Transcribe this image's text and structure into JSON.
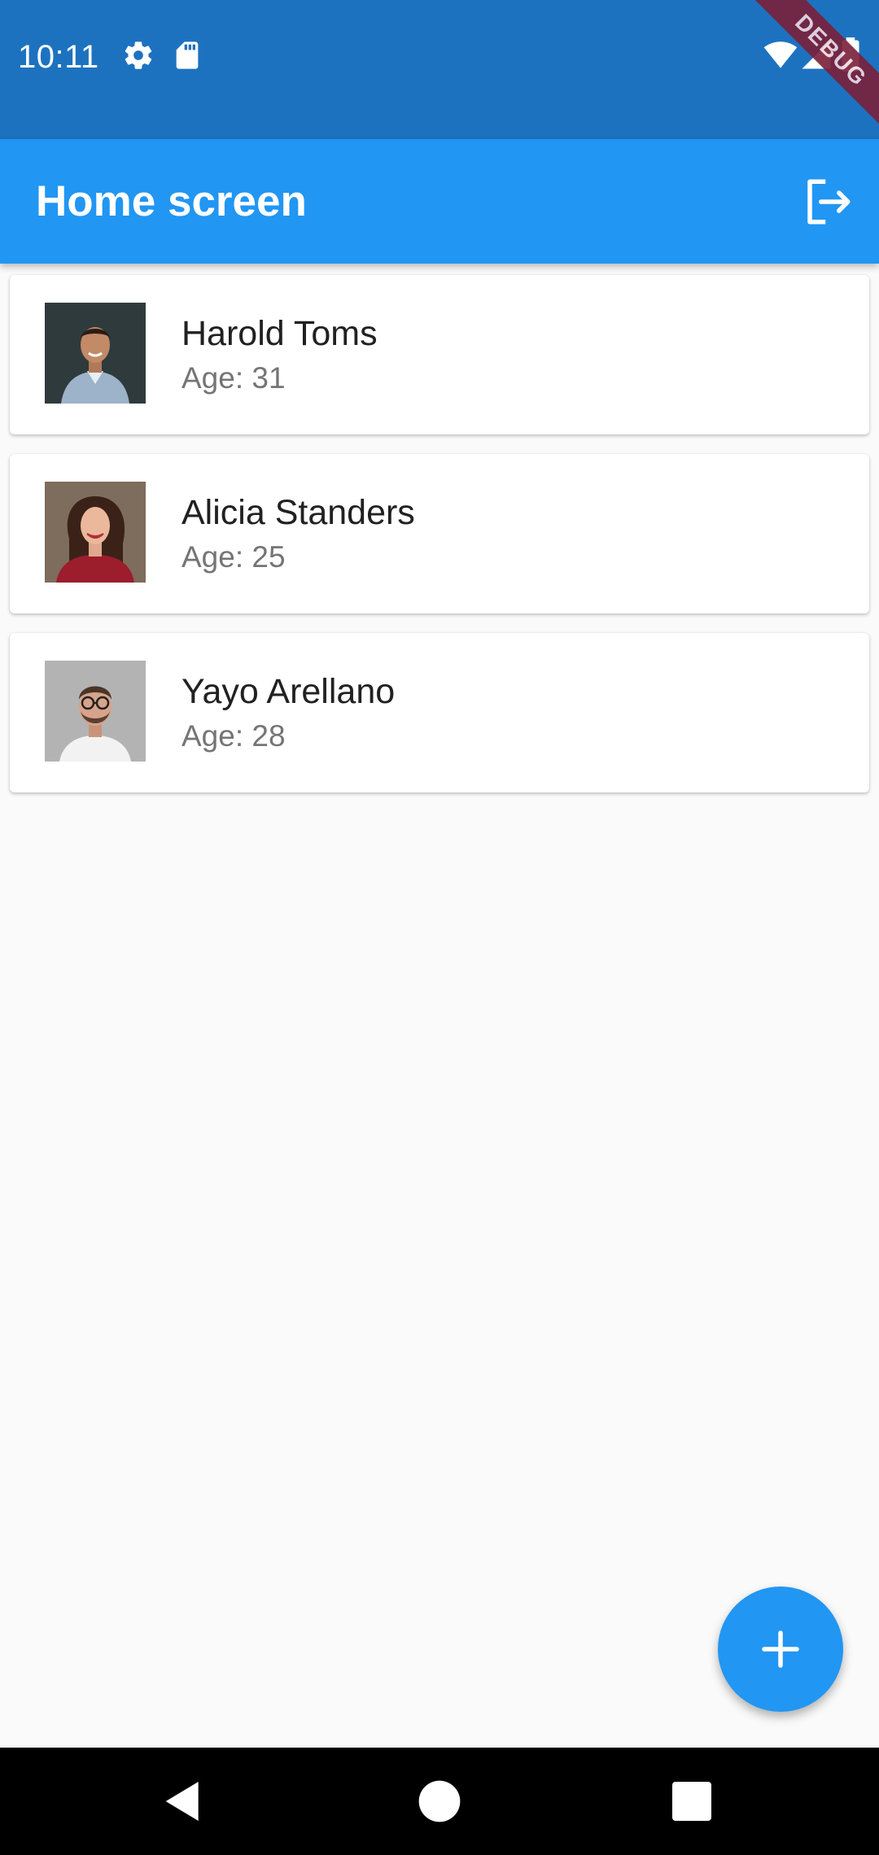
{
  "status_bar": {
    "time": "10:11",
    "icons": [
      "gear-icon",
      "sd-card-icon",
      "wifi-icon",
      "cell-signal-icon",
      "battery-icon"
    ],
    "debug_label": "DEBUG"
  },
  "app_bar": {
    "title": "Home screen",
    "logout_icon": "logout-icon",
    "background": "#2196f3"
  },
  "people": [
    {
      "name": "Harold Toms",
      "age_text": "Age: 31",
      "avatar": "avatar-photo"
    },
    {
      "name": "Alicia Standers",
      "age_text": "Age: 25",
      "avatar": "avatar-photo"
    },
    {
      "name": "Yayo Arellano",
      "age_text": "Age: 28",
      "avatar": "avatar-photo"
    }
  ],
  "fab": {
    "icon": "plus-icon",
    "color": "#2196f3"
  },
  "nav_bar": {
    "buttons": [
      "back-icon",
      "home-icon",
      "recents-icon"
    ]
  },
  "colors": {
    "status_bar": "#1d72bf",
    "primary": "#2196f3",
    "background": "#fafafa",
    "name_text": "#212121",
    "age_text": "#757575"
  }
}
